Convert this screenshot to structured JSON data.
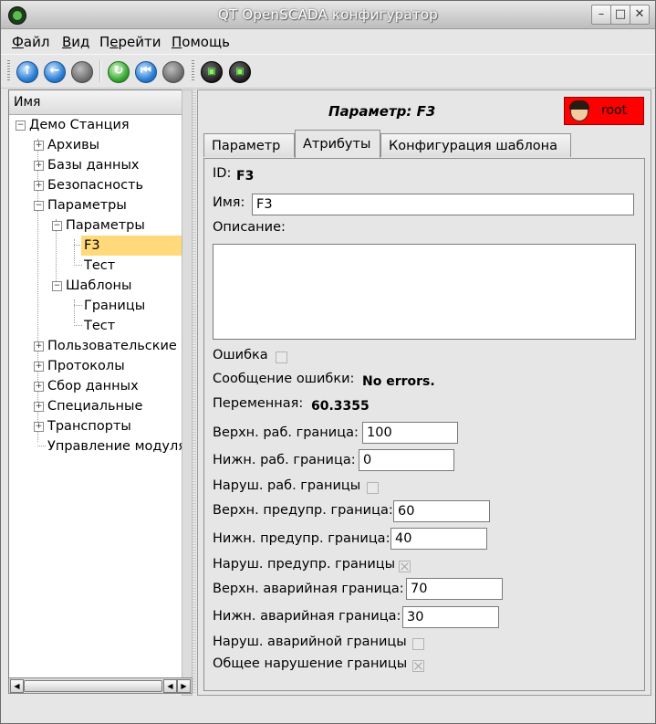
{
  "window": {
    "title": "QT OpenSCADA конфигуратор"
  },
  "menu": [
    {
      "label": "Файл",
      "accel": "Ф",
      "rest": "айл"
    },
    {
      "label": "Вид",
      "accel": "В",
      "rest": "ид"
    },
    {
      "label": "Перейти",
      "accel": "е",
      "pre": "П",
      "rest": "рейти"
    },
    {
      "label": "Помощь",
      "accel": "П",
      "rest": "омощь"
    }
  ],
  "tree": {
    "header": "Имя",
    "nodes": [
      {
        "label": "Демо Станция",
        "expanded": true
      },
      {
        "label": "Архивы"
      },
      {
        "label": "Базы данных"
      },
      {
        "label": "Безопасность"
      },
      {
        "label": "Параметры",
        "expanded": true
      },
      {
        "label": "Параметры",
        "expanded": true
      },
      {
        "label": "F3",
        "selected": true
      },
      {
        "label": "Тест"
      },
      {
        "label": "Шаблоны",
        "expanded": true
      },
      {
        "label": "Границы"
      },
      {
        "label": "Тест"
      },
      {
        "label": "Пользовательские и"
      },
      {
        "label": "Протоколы"
      },
      {
        "label": "Сбор данных"
      },
      {
        "label": "Специальные"
      },
      {
        "label": "Транспорты"
      },
      {
        "label": "Управление модуля"
      }
    ]
  },
  "panel": {
    "title": "Параметр: F3",
    "user": "root",
    "tabs": [
      "Параметр",
      "Атрибуты",
      "Конфигурация шаблона"
    ],
    "active_tab": 1,
    "fields": {
      "id_label": "ID:",
      "id_value": "F3",
      "name_label": "Имя:",
      "name_value": "F3",
      "desc_label": "Описание:",
      "error_label": "Ошибка",
      "errmsg_label": "Сообщение ошибки:",
      "errmsg_value": "No errors.",
      "var_label": "Переменная:",
      "var_value": "60.3355",
      "hwork_label": "Верхн. раб. граница:",
      "hwork_value": "100",
      "lwork_label": "Нижн. раб. граница:",
      "lwork_value": "0",
      "vwork_label": "Наруш. раб. границы",
      "hwarn_label": "Верхн. предупр. граница:",
      "hwarn_value": "60",
      "lwarn_label": "Нижн. предупр. граница:",
      "lwarn_value": "40",
      "vwarn_label": "Наруш. предупр. границы",
      "halarm_label": "Верхн. аварийная граница:",
      "halarm_value": "70",
      "lalarm_label": "Нижн. аварийная граница:",
      "lalarm_value": "30",
      "valarm_label": "Наруш. аварийной границы",
      "vall_label": "Общее нарушение границы"
    },
    "checks": {
      "error": false,
      "vwork": false,
      "vwarn": true,
      "valarm": false,
      "vall": true
    }
  }
}
